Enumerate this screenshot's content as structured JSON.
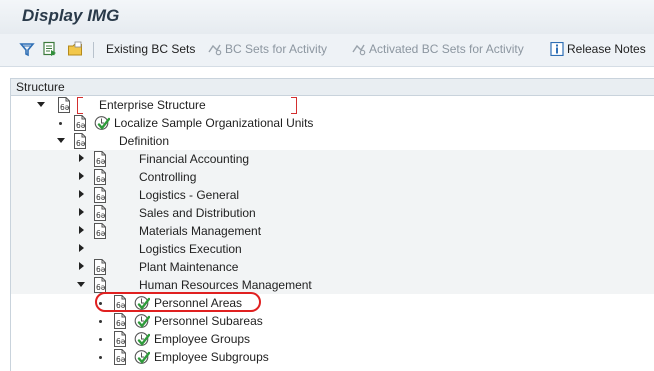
{
  "window": {
    "title": "Display IMG"
  },
  "toolbar": {
    "existing_bc_sets": "Existing BC Sets",
    "bc_sets_for_activity": "BC Sets for Activity",
    "activated_bc_sets_for_activity": "Activated BC Sets for Activity",
    "release_notes": "Release Notes"
  },
  "structure": {
    "header": "Structure",
    "items": [
      {
        "label": "Enterprise Structure",
        "level": 0,
        "expander": "expanded",
        "focused": true
      },
      {
        "label": "Localize Sample Organizational Units",
        "level": 1,
        "expander": "bullet",
        "executable": true
      },
      {
        "label": "Definition",
        "level": 1,
        "expander": "expanded"
      },
      {
        "label": "Financial Accounting",
        "level": 2,
        "expander": "collapsed"
      },
      {
        "label": "Controlling",
        "level": 2,
        "expander": "collapsed"
      },
      {
        "label": "Logistics - General",
        "level": 2,
        "expander": "collapsed"
      },
      {
        "label": "Sales and Distribution",
        "level": 2,
        "expander": "collapsed"
      },
      {
        "label": "Materials Management",
        "level": 2,
        "expander": "collapsed"
      },
      {
        "label": "Logistics Execution",
        "level": 2,
        "expander": "collapsed",
        "no_doc_icon": true
      },
      {
        "label": "Plant Maintenance",
        "level": 2,
        "expander": "collapsed"
      },
      {
        "label": "Human Resources Management",
        "level": 2,
        "expander": "expanded"
      },
      {
        "label": "Personnel Areas",
        "level": 3,
        "expander": "bullet",
        "executable": true,
        "highlighted": true
      },
      {
        "label": "Personnel Subareas",
        "level": 3,
        "expander": "bullet",
        "executable": true
      },
      {
        "label": "Employee Groups",
        "level": 3,
        "expander": "bullet",
        "executable": true
      },
      {
        "label": "Employee Subgroups",
        "level": 3,
        "expander": "bullet",
        "executable": true
      }
    ]
  },
  "colors": {
    "highlight_ring": "#e02020",
    "focus_bracket": "#d32f2f",
    "exec_check": "#2e9a3a",
    "toolbar_accent": "#2f6fb5"
  }
}
